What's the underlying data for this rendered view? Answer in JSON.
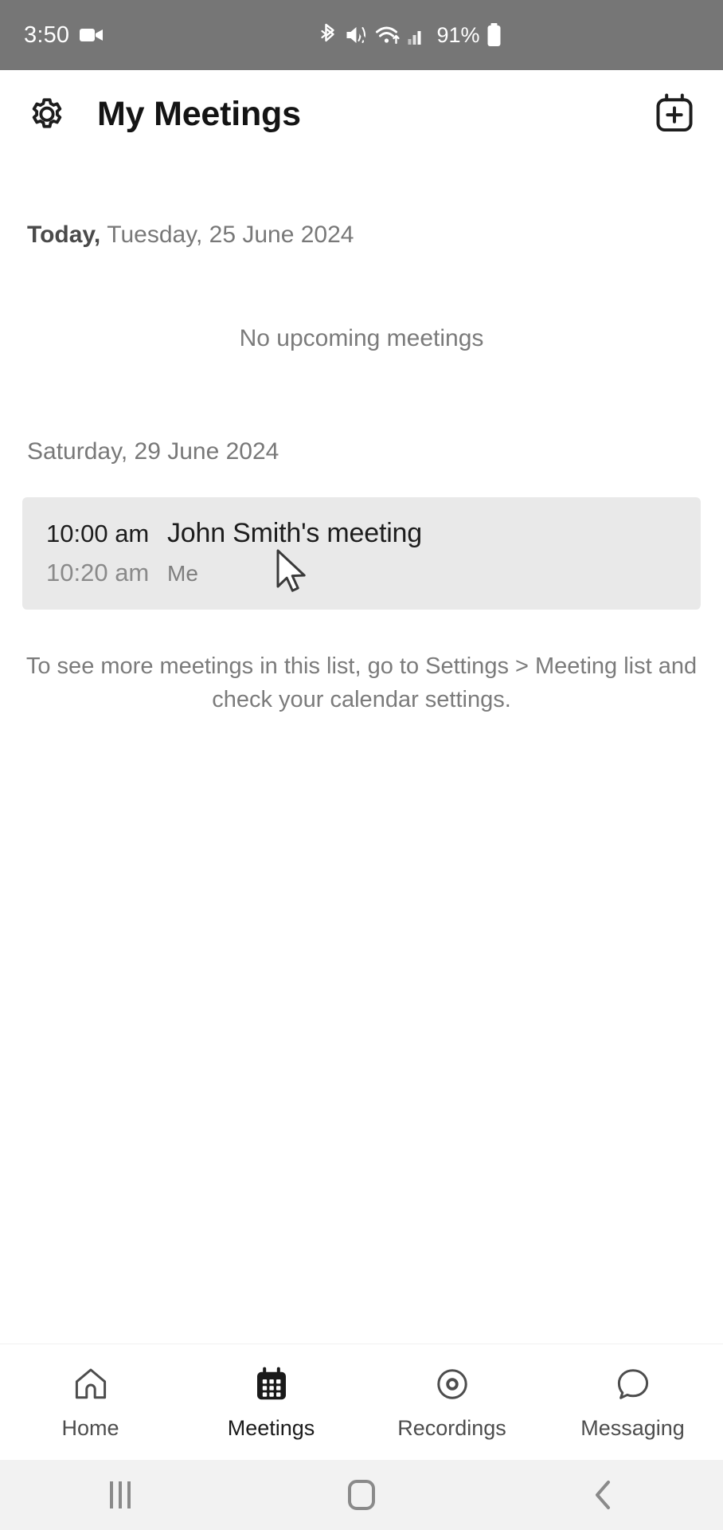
{
  "status_bar": {
    "time": "3:50",
    "battery_percent": "91%",
    "icons": [
      "video-camera-icon",
      "bluetooth-icon",
      "sound-mute-vibrate-icon",
      "wifi-icon",
      "cellular-signal-icon",
      "battery-icon"
    ],
    "background_color": "#767676"
  },
  "header": {
    "title": "My Meetings",
    "settings_icon": "gear-icon",
    "add_icon": "calendar-plus-icon"
  },
  "content": {
    "today_label": "Today,",
    "today_date": "Tuesday, 25 June 2024",
    "empty_message": "No upcoming meetings",
    "second_day_date": "Saturday, 29 June 2024",
    "meeting": {
      "start_time": "10:00 am",
      "end_time": "10:20 am",
      "title": "John Smith's meeting",
      "organizer": "Me",
      "card_color": "#e9e9e9"
    },
    "hint": "To see more meetings in this list, go to Settings > Meeting list and check your calendar settings."
  },
  "bottom_nav": {
    "items": [
      {
        "label": "Home",
        "icon": "home-icon",
        "active": false
      },
      {
        "label": "Meetings",
        "icon": "calendar-icon",
        "active": true
      },
      {
        "label": "Recordings",
        "icon": "record-circle-icon",
        "active": false
      },
      {
        "label": "Messaging",
        "icon": "speech-bubble-icon",
        "active": false
      }
    ]
  },
  "android_nav": {
    "recents_icon": "recents-icon",
    "home_icon": "home-square-icon",
    "back_icon": "back-chevron-icon"
  }
}
